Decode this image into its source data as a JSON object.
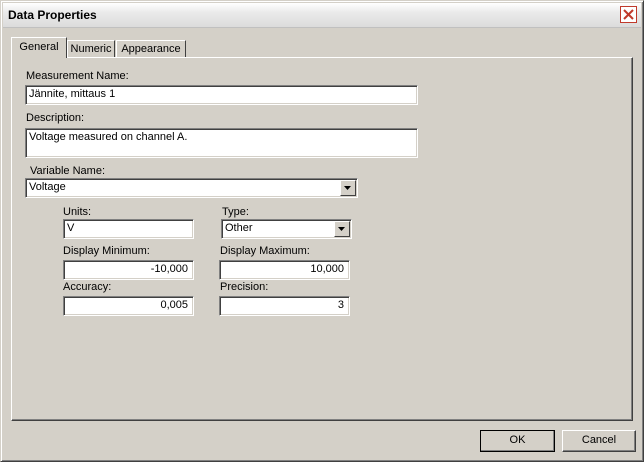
{
  "window": {
    "title": "Data Properties"
  },
  "tabs": [
    {
      "label": "General",
      "active": true
    },
    {
      "label": "Numeric",
      "active": false
    },
    {
      "label": "Appearance",
      "active": false
    }
  ],
  "general": {
    "measurement_name": {
      "label": "Measurement Name:",
      "value": "Jännite, mittaus 1"
    },
    "description": {
      "label": "Description:",
      "value": "Voltage measured on channel A."
    },
    "variable_name": {
      "label": "Variable Name:",
      "value": "Voltage"
    },
    "units": {
      "label": "Units:",
      "value": "V"
    },
    "type": {
      "label": "Type:",
      "value": "Other"
    },
    "display_minimum": {
      "label": "Display Minimum:",
      "value": "-10,000"
    },
    "display_maximum": {
      "label": "Display Maximum:",
      "value": "10,000"
    },
    "accuracy": {
      "label": "Accuracy:",
      "value": "0,005"
    },
    "precision": {
      "label": "Precision:",
      "value": "3"
    }
  },
  "buttons": {
    "ok": "OK",
    "cancel": "Cancel"
  },
  "icons": {
    "close": "close-icon",
    "dropdown": "chevron-down-icon"
  },
  "colors": {
    "close_border": "#c0392b",
    "face": "#d4d0c8"
  }
}
